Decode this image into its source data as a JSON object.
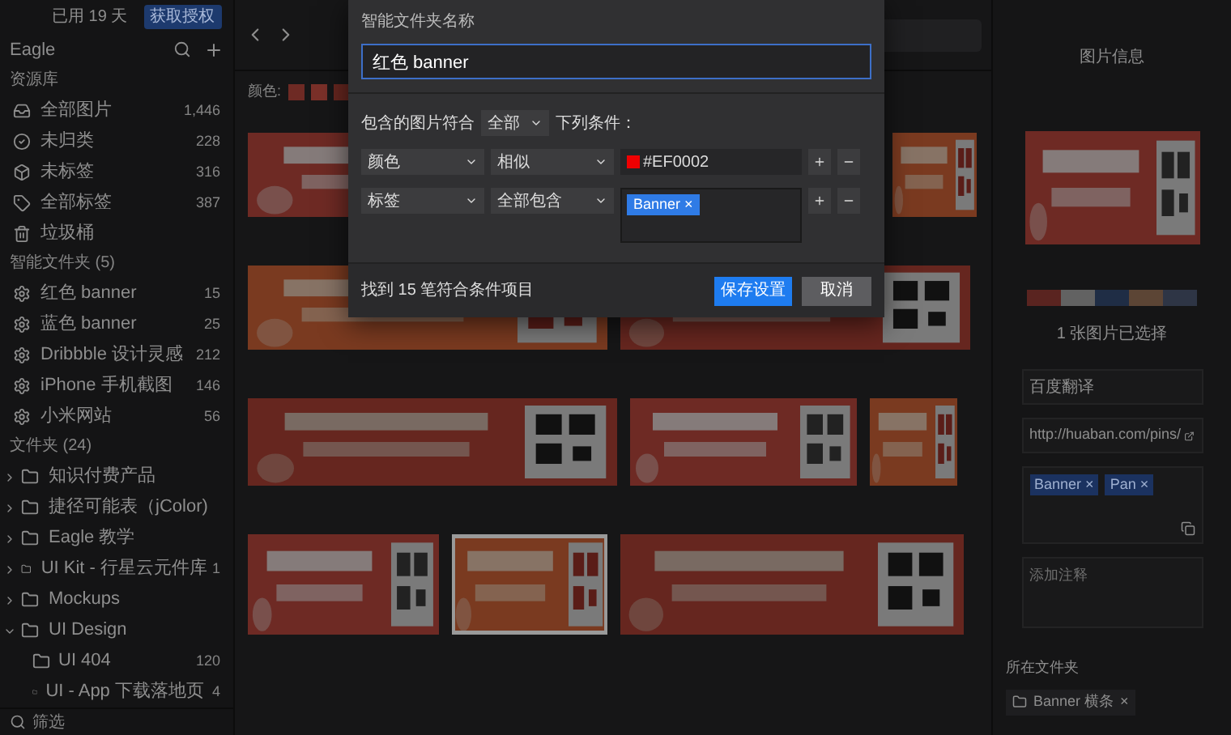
{
  "titlebar": {
    "trial": "已用 19 天",
    "buy_button": "获取授权"
  },
  "sidebar": {
    "title": "Eagle",
    "sections": [
      {
        "heading": "资源库",
        "items": [
          {
            "label": "全部图片",
            "count": "1,446"
          },
          {
            "label": "未归类",
            "count": "228"
          },
          {
            "label": "未标签",
            "count": "316"
          },
          {
            "label": "全部标签",
            "count": "387"
          },
          {
            "label": "垃圾桶"
          }
        ]
      },
      {
        "heading": "智能文件夹 (5)",
        "items": [
          {
            "label": "红色 banner",
            "count": "15"
          },
          {
            "label": "蓝色 banner",
            "count": "25"
          },
          {
            "label": "Dribbble 设计灵感",
            "count": "212"
          },
          {
            "label": "iPhone 手机截图",
            "count": "146"
          },
          {
            "label": "小米网站",
            "count": "56"
          }
        ]
      }
    ],
    "folders_heading": "文件夹 (24)",
    "folders": [
      {
        "label": "知识付费产品",
        "expanded": false
      },
      {
        "label": "捷径可能表（jColor)",
        "expanded": false
      },
      {
        "label": "Eagle 教学",
        "expanded": false
      },
      {
        "label": "UI Kit - 行星云元件库",
        "count": "1",
        "expanded": false
      },
      {
        "label": "Mockups",
        "expanded": false
      },
      {
        "label": "UI Design",
        "expanded": true,
        "children": [
          {
            "label": "UI 404",
            "count": "120"
          },
          {
            "label": "UI - App 下载落地页",
            "count": "4"
          }
        ]
      }
    ],
    "filter_placeholder": "筛选"
  },
  "toolbar": {
    "color_label": "颜色:",
    "swatches": [
      {
        "color": "#6e2a24"
      },
      {
        "color": "#7a3029"
      },
      {
        "color": "#66261f"
      }
    ]
  },
  "grid": {
    "rows": [
      [
        {
          "selected": false
        },
        {
          "selected": false
        }
      ],
      [
        {
          "selected": false
        },
        {
          "selected": false
        }
      ],
      [
        {
          "selected": false
        },
        {
          "selected": false
        },
        {
          "selected": false
        }
      ],
      [
        {
          "selected": false
        },
        {
          "selected": true
        },
        {
          "selected": false
        }
      ]
    ]
  },
  "info": {
    "title": "图片信息",
    "palette": [
      {
        "color": "#5a2420"
      },
      {
        "color": "#626262"
      },
      {
        "color": "#1f2d45"
      },
      {
        "color": "#5c4535"
      },
      {
        "color": "#2e3545"
      }
    ],
    "selected_text": "1 张图片已选择",
    "name": "百度翻译",
    "url": "http://huaban.com/pins/",
    "tags": [
      {
        "label": "Banner",
        "remove": "×"
      },
      {
        "label": "Pan",
        "remove": "×"
      }
    ],
    "notes_placeholder": "添加注释",
    "folder_heading": "所在文件夹",
    "folder": "Banner 横条",
    "folder_remove": "×"
  },
  "dialog": {
    "name_label": "智能文件夹名称",
    "name_value": "红色 banner",
    "match_prefix": "包含的图片符合",
    "match_value": "全部",
    "match_suffix": "下列条件：",
    "rules": [
      {
        "kind": "color",
        "field": "颜色",
        "operator": "相似",
        "color": "#ef0002",
        "value": "#EF0002"
      },
      {
        "kind": "tags",
        "field": "标签",
        "operator": "全部包含",
        "tags": [
          {
            "label": "Banner",
            "remove": "×"
          }
        ]
      }
    ],
    "result": "找到 15 笔符合条件项目",
    "save": "保存设置",
    "cancel": "取消"
  }
}
